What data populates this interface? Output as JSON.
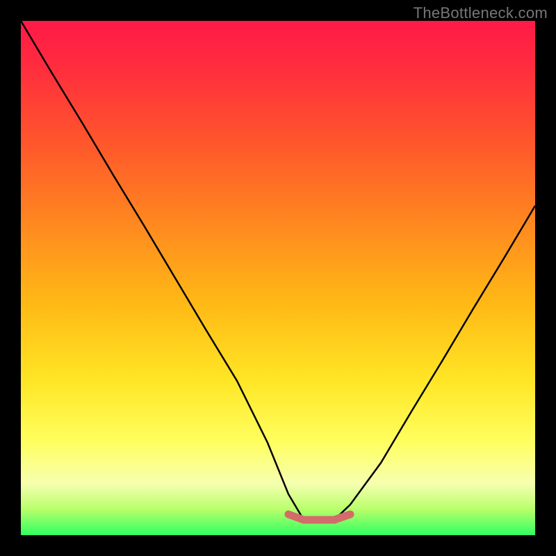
{
  "watermark": "TheBottleneck.com",
  "chart_data": {
    "type": "line",
    "title": "",
    "xlabel": "",
    "ylabel": "",
    "xlim": [
      0,
      100
    ],
    "ylim": [
      0,
      100
    ],
    "series": [
      {
        "name": "bottleneck-curve",
        "x": [
          0,
          6,
          12,
          18,
          24,
          30,
          36,
          42,
          48,
          52,
          55,
          58,
          61,
          64,
          70,
          76,
          82,
          88,
          94,
          100
        ],
        "values": [
          100,
          90,
          80,
          70,
          60,
          50,
          40,
          30,
          18,
          8,
          3,
          3,
          3,
          6,
          14,
          24,
          34,
          44,
          54,
          64
        ]
      },
      {
        "name": "bottom-band",
        "x": [
          52,
          55,
          58,
          61,
          64
        ],
        "values": [
          4,
          3,
          3,
          3,
          4
        ]
      }
    ],
    "colors": {
      "curve": "#000000",
      "band": "#d46a6a",
      "gradient_top": "#ff1a47",
      "gradient_mid": "#ffe625",
      "gradient_bottom": "#2fff62"
    }
  }
}
